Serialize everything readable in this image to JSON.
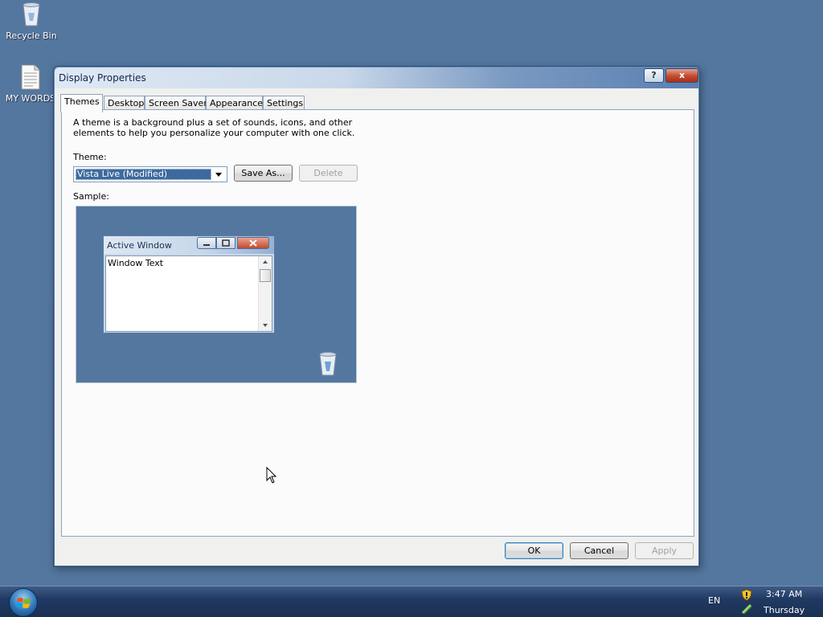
{
  "desktop": {
    "icons": [
      {
        "label": "Recycle Bin",
        "icon": "recycle-bin-icon"
      },
      {
        "label": "MY WORDS",
        "icon": "text-document-icon"
      }
    ]
  },
  "window": {
    "title": "Display Properties",
    "help_icon": "?",
    "close_icon": "x",
    "tabs": [
      {
        "label": "Themes",
        "active": true
      },
      {
        "label": "Desktop",
        "active": false
      },
      {
        "label": "Screen Saver",
        "active": false
      },
      {
        "label": "Appearance",
        "active": false
      },
      {
        "label": "Settings",
        "active": false
      }
    ],
    "description": "A theme is a background plus a set of sounds, icons, and other elements to help you personalize your computer with one click.",
    "theme_label": "Theme:",
    "theme_value": "Vista Live (Modified)",
    "save_as_label": "Save As...",
    "delete_label": "Delete",
    "sample_label": "Sample:",
    "sample": {
      "window_title": "Active Window",
      "window_text": "Window Text"
    },
    "ok_label": "OK",
    "cancel_label": "Cancel",
    "apply_label": "Apply"
  },
  "taskbar": {
    "language": "EN",
    "time": "3:47 AM",
    "day": "Thursday"
  },
  "colors": {
    "desktop": "#54779f",
    "selection": "#3d6a9e",
    "close_button": "#c24a2e"
  }
}
